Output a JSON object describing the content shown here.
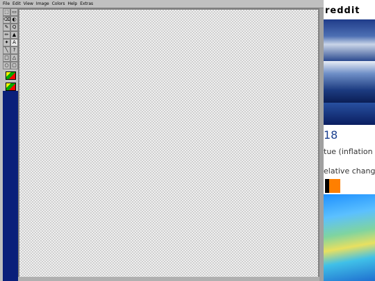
{
  "menu": [
    "File",
    "Edit",
    "View",
    "Image",
    "Colors",
    "Help",
    "Extras"
  ],
  "tools": [
    "select",
    "lasso",
    "eraser",
    "fill",
    "dropper",
    "zoom",
    "pencil",
    "brush",
    "airbrush",
    "text",
    "line",
    "curve",
    "rect",
    "poly",
    "ellipse",
    "roundrect"
  ],
  "tool_glyphs": {
    "text": "A",
    "zoom": "Q"
  },
  "side": {
    "banner_text": "reddit",
    "numeral": "18",
    "line1": "tue (inflation",
    "line2": "elative change"
  },
  "colors": {
    "desktop": "#0a1f7a",
    "canvas": "#f0f0f0",
    "accent": "#ff7f00"
  }
}
